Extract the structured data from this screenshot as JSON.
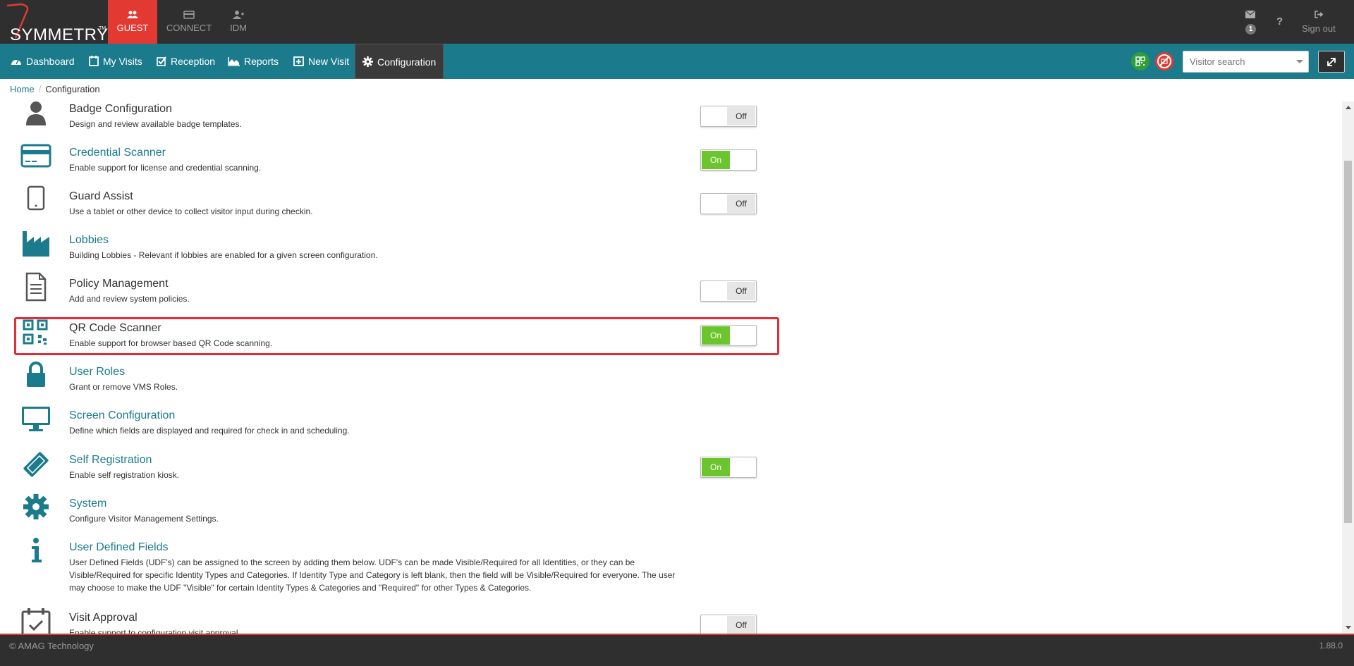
{
  "brand": {
    "name": "SYMMETRY",
    "tm": "TM"
  },
  "app_tabs": [
    {
      "label": "GUEST",
      "icon": "users-icon"
    },
    {
      "label": "CONNECT",
      "icon": "card-icon"
    },
    {
      "label": "IDM",
      "icon": "user-plus-icon"
    }
  ],
  "header": {
    "message_count": "1",
    "help_label": "?",
    "signout_label": "Sign out"
  },
  "nav": {
    "items": [
      {
        "label": "Dashboard",
        "icon": "dashboard-icon"
      },
      {
        "label": "My Visits",
        "icon": "calendar-icon"
      },
      {
        "label": "Reception",
        "icon": "checkbox-icon"
      },
      {
        "label": "Reports",
        "icon": "area-chart-icon"
      },
      {
        "label": "New Visit",
        "icon": "calendar-plus-icon"
      },
      {
        "label": "Configuration",
        "icon": "gear-icon"
      }
    ],
    "active": "Configuration"
  },
  "search": {
    "placeholder": "Visitor search"
  },
  "breadcrumb": {
    "home": "Home",
    "current": "Configuration"
  },
  "config_items": [
    {
      "title": "Badge Configuration",
      "desc": "Design and review available badge templates.",
      "icon": "user-icon",
      "link": false,
      "toggle": "Off"
    },
    {
      "title": "Credential Scanner",
      "desc": "Enable support for license and credential scanning.",
      "icon": "credit-card-icon",
      "link": true,
      "toggle": "On"
    },
    {
      "title": "Guard Assist",
      "desc": "Use a tablet or other device to collect visitor input during checkin.",
      "icon": "tablet-icon",
      "link": false,
      "toggle": "Off"
    },
    {
      "title": "Lobbies",
      "desc": "Building Lobbies - Relevant if lobbies are enabled for a given screen configuration.",
      "icon": "industry-icon",
      "link": true,
      "toggle": ""
    },
    {
      "title": "Policy Management",
      "desc": "Add and review system policies.",
      "icon": "document-icon",
      "link": false,
      "toggle": "Off"
    },
    {
      "title": "QR Code Scanner",
      "desc": "Enable support for browser based QR Code scanning.",
      "icon": "qr-code-icon",
      "link": false,
      "toggle": "On"
    },
    {
      "title": "User Roles",
      "desc": "Grant or remove VMS Roles.",
      "icon": "lock-icon",
      "link": true,
      "toggle": ""
    },
    {
      "title": "Screen Configuration",
      "desc": "Define which fields are displayed and required for check in and scheduling.",
      "icon": "monitor-icon",
      "link": true,
      "toggle": ""
    },
    {
      "title": "Self Registration",
      "desc": "Enable self registration kiosk.",
      "icon": "ticket-icon",
      "link": true,
      "toggle": "On"
    },
    {
      "title": "System",
      "desc": "Configure Visitor Management Settings.",
      "icon": "gear-icon",
      "link": true,
      "toggle": ""
    },
    {
      "title": "User Defined Fields",
      "desc": "User Defined Fields (UDF's) can be assigned to the screen by adding them below. UDF's can be made Visible/Required for all Identities, or they can be Visible/Required for specific Identity Types and Categories. If Identity Type and Category is left blank, then the field will be Visible/Required for everyone. The user may choose to make the UDF \"Visible\" for certain Identity Types & Categories and \"Required\" for other Types & Categories.",
      "icon": "info-icon",
      "link": true,
      "toggle": ""
    },
    {
      "title": "Visit Approval",
      "desc": "Enable support to configuration visit approval.",
      "icon": "calendar-check-icon",
      "link": false,
      "toggle": "Off"
    }
  ],
  "footer": {
    "copyright": "© AMAG Technology",
    "version": "1.88.0"
  },
  "colors": {
    "topbar": "#2f2f2f",
    "accent_red": "#e23a33",
    "nav_teal": "#1b7b8c",
    "toggle_on": "#6cc52c",
    "highlight": "#e02d3a"
  }
}
